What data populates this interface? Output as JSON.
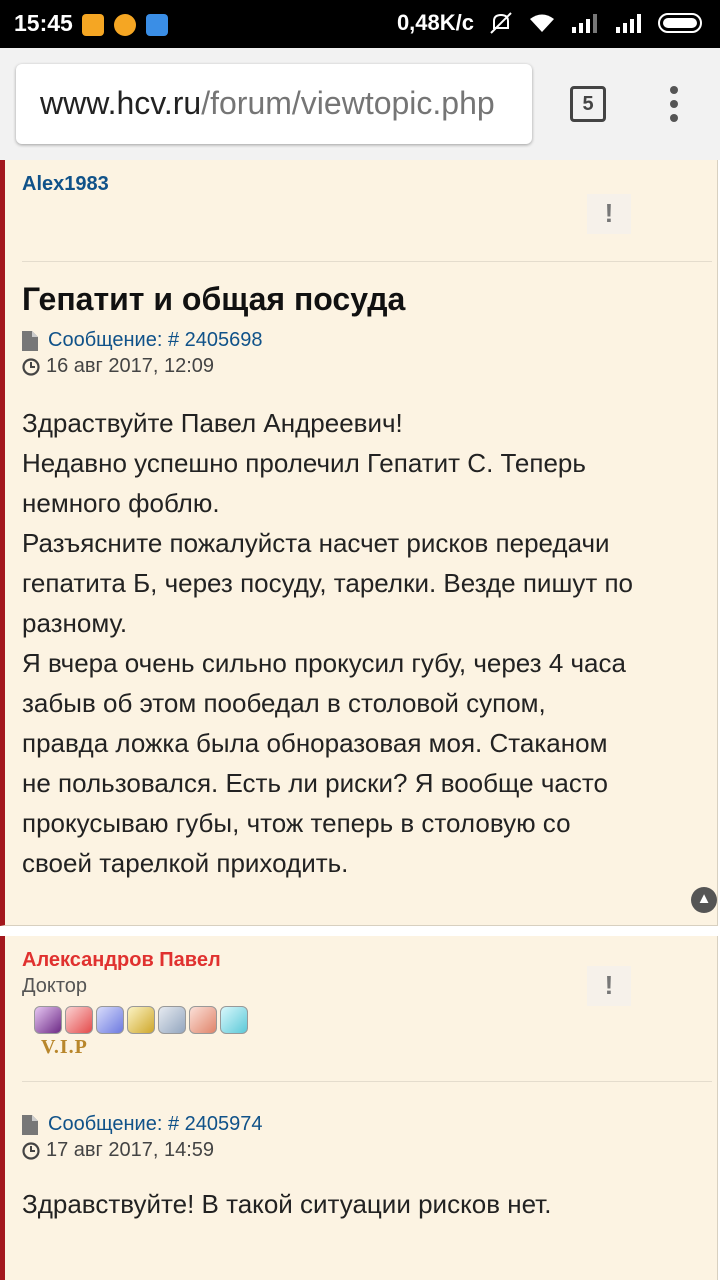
{
  "status_bar": {
    "time": "15:45",
    "speed": "0,48K/c",
    "icons": [
      "mi-icon",
      "app-icon",
      "app-icon",
      "mute-icon",
      "wifi-icon",
      "signal-icon",
      "signal-icon",
      "battery-icon"
    ]
  },
  "browser": {
    "url_host": "www.hcv.ru",
    "url_path": "/forum/viewtopic.php",
    "tab_count": "5"
  },
  "posts": [
    {
      "author": "Alex1983",
      "author_color": "#105289",
      "report_label": "!",
      "title": "Гепатит и общая посуда",
      "message_label": "Сообщение: # 2405698",
      "date": "16 авг 2017, 12:09",
      "body": [
        "Здраствуйте Павел Андреевич!",
        "Недавно успешно пролечил Гепатит С. Теперь",
        "немного фоблю.",
        "Разъясните пожалуйста насчет рисков передачи",
        "гепатита Б, через посуду, тарелки. Везде пишут по",
        "разному.",
        "Я вчера очень сильно прокусил губу, через 4 часа",
        "забыв об этом пообедал в столовой супом,",
        "правда ложка была обноразовая моя. Стаканом",
        "не пользовался. Есть ли риски? Я вообще часто",
        "прокусываю губы, чтож теперь в столовую со",
        "своей тарелкой приходить."
      ]
    },
    {
      "author": "Александров Павел",
      "author_color": "#e0312f",
      "rank": "Доктор",
      "vip_label": "V.I.P",
      "report_label": "!",
      "message_label": "Сообщение: # 2405974",
      "date": "17 авг 2017, 14:59",
      "body": [
        "Здравствуйте! В такой ситуации рисков нет."
      ]
    }
  ],
  "colors": {
    "post_bg": "#fcf3e2",
    "post_border": "#a3171d",
    "link": "#105289"
  }
}
